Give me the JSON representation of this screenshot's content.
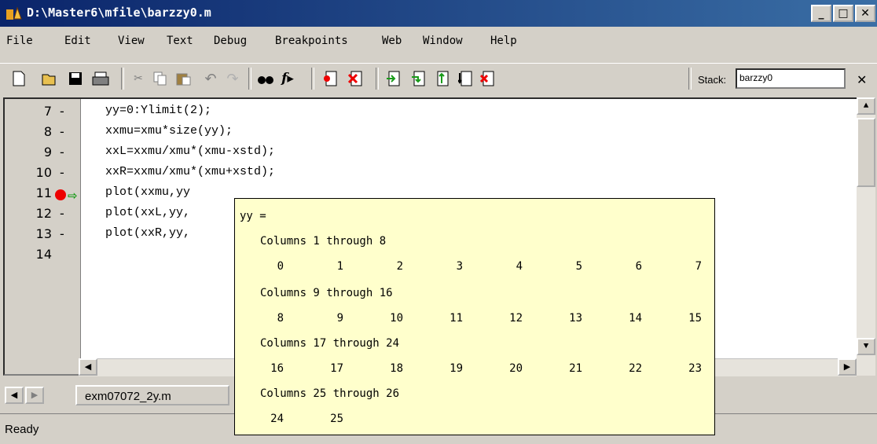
{
  "window": {
    "title": "D:\\Master6\\mfile\\barzzy0.m",
    "min": "_",
    "max": "□",
    "close": "✕"
  },
  "menu": [
    "File",
    "Edit",
    "View",
    "Text",
    "Debug",
    "Breakpoints",
    "Web",
    "Window",
    "Help"
  ],
  "toolbar": {
    "stack_label": "Stack:",
    "stack_value": "barzzy0",
    "close": "✕"
  },
  "editor": {
    "lines": [
      {
        "num": "7",
        "marker": "-",
        "code": "yy=0:Ylimit(2);"
      },
      {
        "num": "8",
        "marker": "-",
        "code": "xxmu=xmu*size(yy);"
      },
      {
        "num": "9",
        "marker": "-",
        "code": "xxL=xxmu/xmu*(xmu-xstd);"
      },
      {
        "num": "10",
        "marker": "-",
        "code": "xxR=xxmu/xmu*(xmu+xstd);"
      },
      {
        "num": "11",
        "marker": "",
        "code": "plot(xxmu,yy"
      },
      {
        "num": "12",
        "marker": "-",
        "code": "plot(xxL,yy,"
      },
      {
        "num": "13",
        "marker": "-",
        "code": "plot(xxR,yy,"
      },
      {
        "num": "14",
        "marker": "",
        "code": ""
      }
    ]
  },
  "tooltip": {
    "header": "yy =",
    "groups": [
      {
        "label": "Columns 1 through 8",
        "values": [
          "0",
          "1",
          "2",
          "3",
          "4",
          "5",
          "6",
          "7"
        ]
      },
      {
        "label": "Columns 9 through 16",
        "values": [
          "8",
          "9",
          "10",
          "11",
          "12",
          "13",
          "14",
          "15"
        ]
      },
      {
        "label": "Columns 17 through 24",
        "values": [
          "16",
          "17",
          "18",
          "19",
          "20",
          "21",
          "22",
          "23"
        ]
      },
      {
        "label": "Columns 25 through 26",
        "values": [
          "24",
          "25"
        ]
      }
    ]
  },
  "tabs": [
    "exm07072_2y.m"
  ],
  "status": "Ready"
}
